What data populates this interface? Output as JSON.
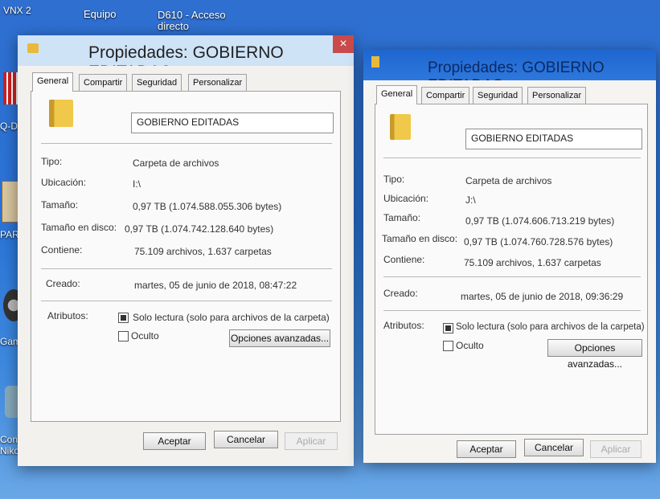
{
  "desktop": {
    "labels": [
      "VNX 2",
      "Equipo",
      "D610 - Acceso directo",
      "Q-D",
      "PAR",
      "GamO",
      "Contro Nikon"
    ]
  },
  "window_left": {
    "title": "Propiedades: GOBIERNO EDITADAS",
    "tabs": [
      "General",
      "Compartir",
      "Seguridad",
      "Personalizar"
    ],
    "folder_name": "GOBIERNO EDITADAS",
    "rows": [
      {
        "label": "Tipo:",
        "value": "Carpeta de archivos"
      },
      {
        "label": "Ubicación:",
        "value": "I:\\"
      },
      {
        "label": "Tamaño:",
        "value": "0,97 TB (1.074.588.055.306 bytes)"
      },
      {
        "label": "Tamaño en disco:",
        "value": "0,97 TB (1.074.742.128.640 bytes)"
      },
      {
        "label": "Contiene:",
        "value": "75.109 archivos, 1.637 carpetas"
      }
    ],
    "created_label": "Creado:",
    "created_value": "martes, 05 de junio de 2018, 08:47:22",
    "attributes_label": "Atributos:",
    "readonly_label": "Solo lectura (solo para archivos de la carpeta)",
    "hidden_label": "Oculto",
    "advanced_button": "Opciones avanzadas...",
    "ok_button": "Aceptar",
    "cancel_button": "Cancelar",
    "apply_button": "Aplicar",
    "close_glyph": "×"
  },
  "window_right": {
    "title": "Propiedades: GOBIERNO EDITADAS",
    "tabs": [
      "General",
      "Compartir",
      "Seguridad",
      "Personalizar"
    ],
    "folder_name": "GOBIERNO EDITADAS",
    "rows": [
      {
        "label": "Tipo:",
        "value": "Carpeta de archivos"
      },
      {
        "label": "Ubicación:",
        "value": "J:\\"
      },
      {
        "label": "Tamaño:",
        "value": "0,97 TB (1.074.606.713.219 bytes)"
      },
      {
        "label": "Tamaño en disco:",
        "value": "0,97 TB (1.074.760.728.576 bytes)"
      },
      {
        "label": "Contiene:",
        "value": "75.109 archivos, 1.637 carpetas"
      }
    ],
    "created_label": "Creado:",
    "created_value": "martes, 05 de junio de 2018, 09:36:29",
    "attributes_label": "Atributos:",
    "readonly_label": "Solo lectura (solo para archivos de la carpeta)",
    "hidden_label": "Oculto",
    "advanced_button": "Opciones avanzadas...",
    "ok_button": "Aceptar",
    "cancel_button": "Cancelar",
    "apply_button": "Aplicar"
  },
  "colors": {
    "desktop_blue": "#2f6fd0",
    "left_titlebar": "#cfe3f7",
    "right_titlebar": "#1f66d0",
    "folder_yellow": "#f0c84a",
    "close_red": "#c94a4a"
  }
}
